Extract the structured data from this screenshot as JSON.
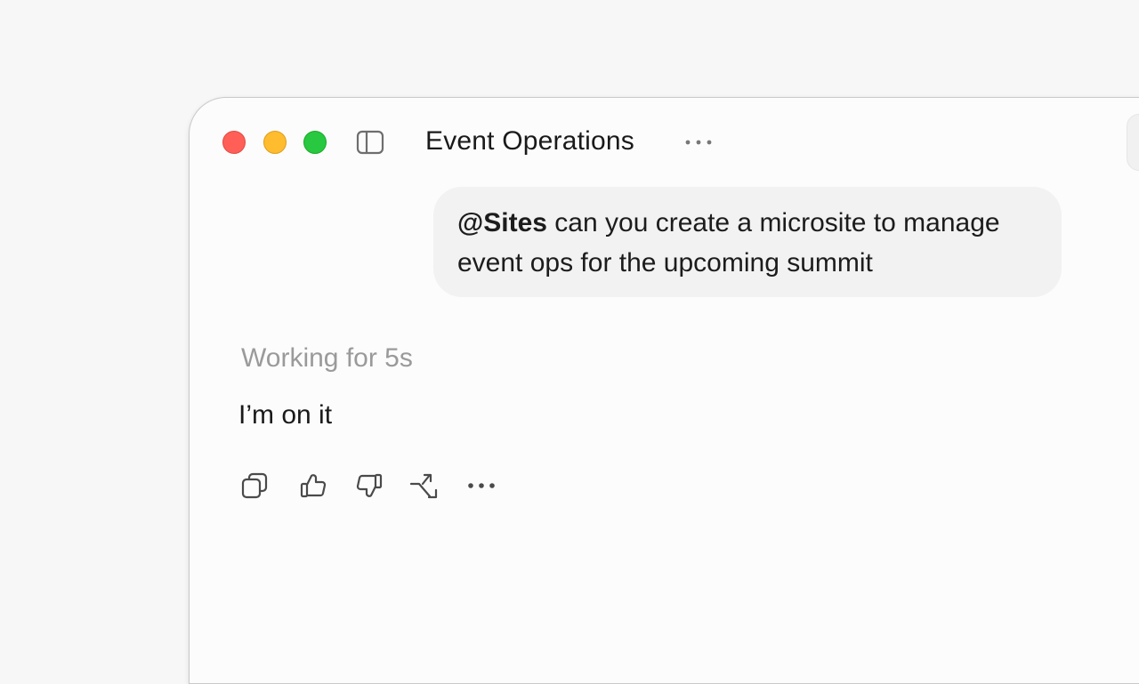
{
  "window": {
    "title": "Event Operations"
  },
  "icons": {
    "sidebar_toggle": "sidebar-icon",
    "title_more": "ellipsis-icon",
    "copy": "copy-icon",
    "thumbs_up": "thumbs-up-icon",
    "thumbs_down": "thumbs-down-icon",
    "branch": "branch-icon",
    "more": "ellipsis-icon"
  },
  "message": {
    "mention": "@Sites",
    "text": " can you create a microsite to manage event ops for the upcoming summit"
  },
  "status": {
    "working": "Working for 5s"
  },
  "reply": {
    "text": "I’m on it"
  },
  "colors": {
    "close": "#ff5f57",
    "minimize": "#febc2e",
    "maximize": "#28c840",
    "bubble_bg": "#f2f2f2",
    "muted_text": "#9a9a9a"
  }
}
